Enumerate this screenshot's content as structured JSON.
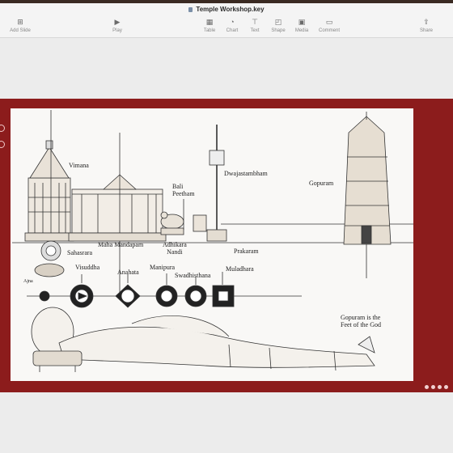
{
  "window": {
    "title": "Temple Workshop.key"
  },
  "toolbar": {
    "items": [
      {
        "label": "Add Slide",
        "icon": "add-slide-icon"
      },
      {
        "label": "Play",
        "icon": "play-icon"
      },
      {
        "label": "Table",
        "icon": "table-icon"
      },
      {
        "label": "Chart",
        "icon": "chart-icon"
      },
      {
        "label": "Text",
        "icon": "text-icon"
      },
      {
        "label": "Shape",
        "icon": "shape-icon"
      },
      {
        "label": "Media",
        "icon": "media-icon"
      },
      {
        "label": "Comment",
        "icon": "comment-icon"
      },
      {
        "label": "Share",
        "icon": "share-icon"
      }
    ]
  },
  "slide": {
    "background": "#8c1c1c",
    "labels": {
      "vimana": "Vimana",
      "bali_peetham": "Bali\nPeetham",
      "dwajastambham": "Dwajastambham",
      "gopuram": "Gopuram",
      "maha_mandapam": "Maha Mandapam",
      "adhikara_nandi": "Adhikara\nNandi",
      "prakaram": "Prakaram",
      "sahasrara": "Sahasrara",
      "visuddha": "Visuddha",
      "anahata": "Anahata",
      "manipura": "Manipura",
      "swadhisthana": "Swadhisthana",
      "muladhara": "Muladhara",
      "ajna": "Ajna",
      "caption": "Gopuram is the\nFeet of the God"
    }
  }
}
